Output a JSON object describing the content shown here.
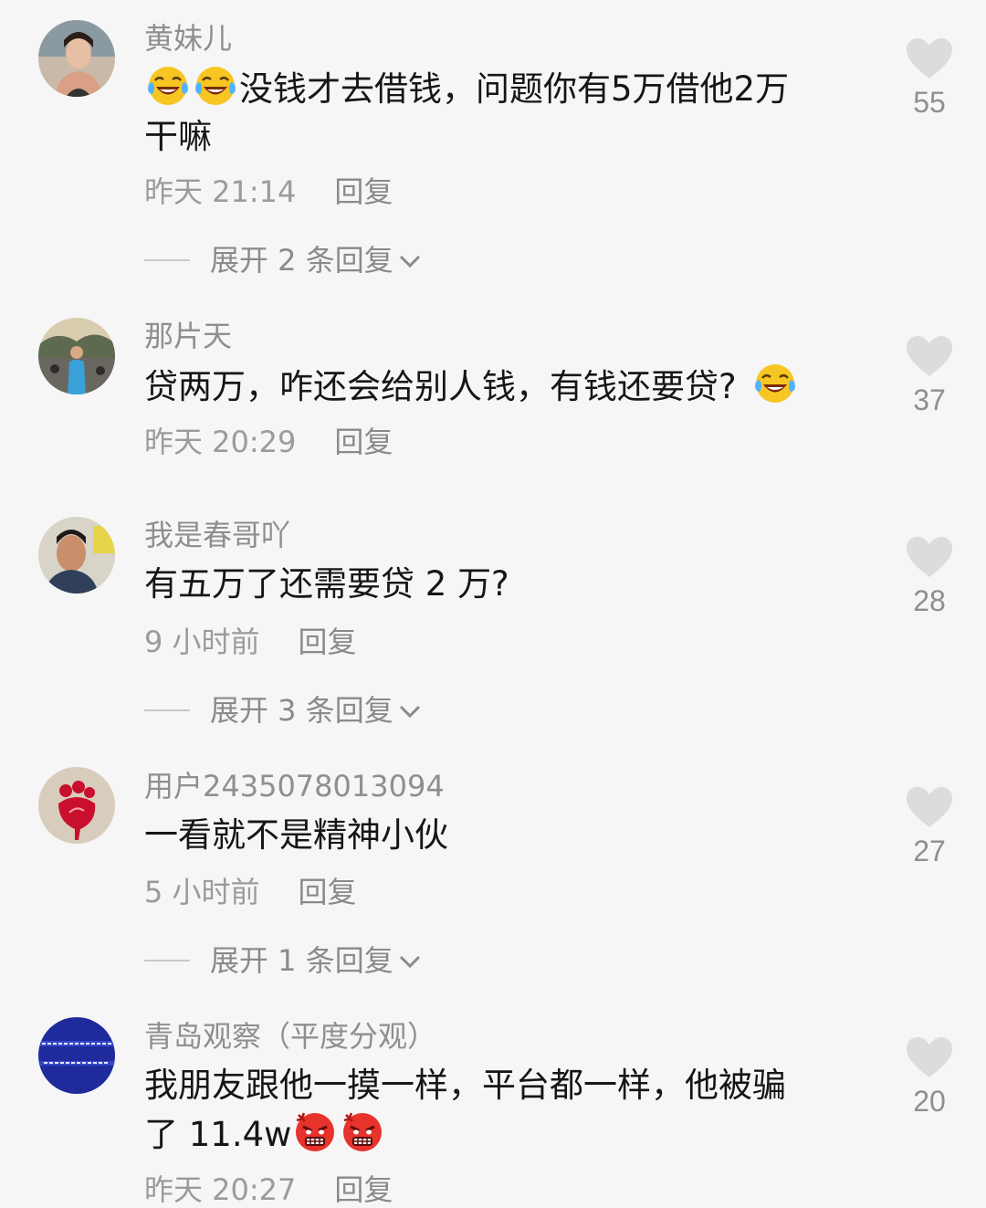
{
  "comments": [
    {
      "username": "黄妹儿",
      "text_a": "没钱才去借钱，问题你有5万借他2万",
      "text_b": "干嘛",
      "time": "昨天 21:14",
      "reply": "回复",
      "expand": "展开 2 条回复",
      "likes": "55",
      "emojis": [
        "laughing-crying-emoji",
        "laughing-crying-emoji"
      ]
    },
    {
      "username": "那片天",
      "text_a": "贷两万，咋还会给别人钱，有钱还要贷?",
      "time": "昨天 20:29",
      "reply": "回复",
      "likes": "37",
      "emojis": [
        "laughing-crying-emoji"
      ]
    },
    {
      "username": "我是春哥吖",
      "text_a": "有五万了还需要贷 2 万?",
      "time": "9 小时前",
      "reply": "回复",
      "expand": "展开 3 条回复",
      "likes": "28"
    },
    {
      "username": "用户2435078013094",
      "text_a": "一看就不是精神小伙",
      "time": "5 小时前",
      "reply": "回复",
      "expand": "展开 1 条回复",
      "likes": "27"
    },
    {
      "username": "青岛观察（平度分观）",
      "text_a": "我朋友跟他一摸一样，平台都一样，他被骗",
      "text_b": "了 11.4w",
      "time": "昨天 20:27",
      "reply": "回复",
      "likes": "20",
      "emojis": [
        "angry-face-emoji",
        "angry-face-emoji"
      ]
    }
  ],
  "icons": {
    "like": "heart-icon",
    "expand": "chevron-down-icon"
  },
  "colors": {
    "background": "#f6f6f6",
    "text": "#161616",
    "secondary": "#8e8e93",
    "heart": "#dcdcdc"
  }
}
